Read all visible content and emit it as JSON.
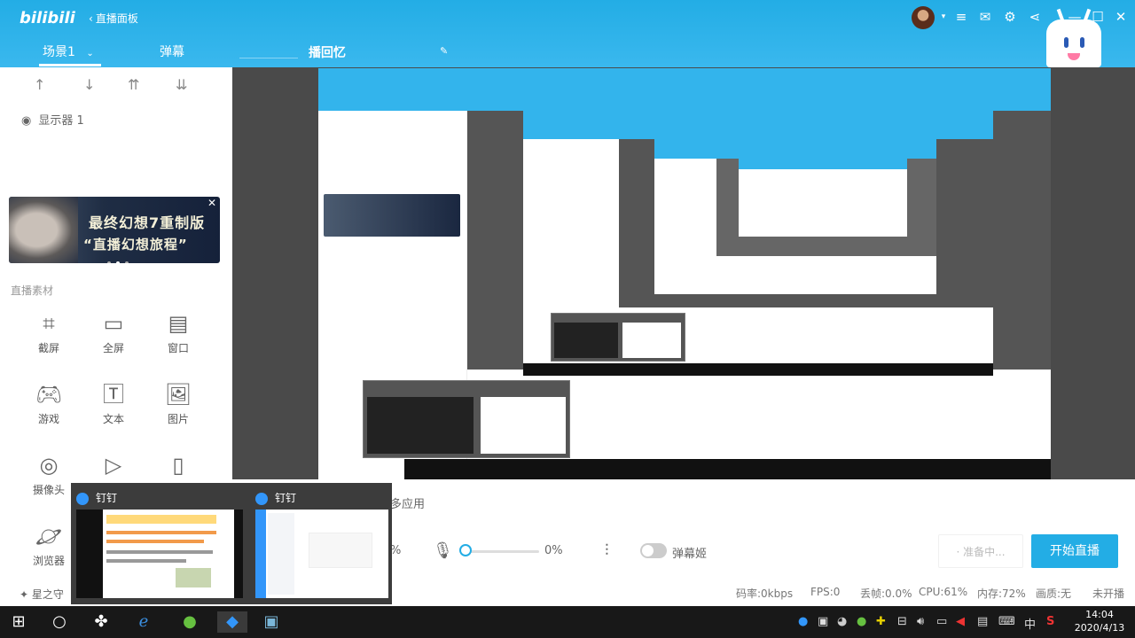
{
  "header": {
    "logo": "bilibili",
    "back_label": "直播面板",
    "scene_tab": "场景1",
    "danmu_tab": "弹幕",
    "room_title": "播回忆",
    "brand_color": "#23ade5"
  },
  "sidebar": {
    "display_item": "显示器 1",
    "banner_line1": "最终幻想7重制版",
    "banner_line2": "直播幻想旅程",
    "section_title": "直播素材",
    "tools": [
      {
        "label": "截屏",
        "icon": "crop-icon"
      },
      {
        "label": "全屏",
        "icon": "monitor-icon"
      },
      {
        "label": "窗口",
        "icon": "window-icon"
      },
      {
        "label": "游戏",
        "icon": "gamepad-icon"
      },
      {
        "label": "文本",
        "icon": "text-icon"
      },
      {
        "label": "图片",
        "icon": "image-icon"
      },
      {
        "label": "摄像头",
        "icon": "camera-icon"
      },
      {
        "label": "",
        "icon": "video-icon"
      },
      {
        "label": "",
        "icon": "phone-icon"
      },
      {
        "label": "浏览器",
        "icon": "planet-icon"
      }
    ],
    "star_label": "星之守"
  },
  "controls": {
    "multi_app": "多应用",
    "left_percent": "%",
    "mic_value": "0%",
    "danmu_toggle_label": "弹幕姬",
    "ready_label": "· 准备中...",
    "start_label": "开始直播"
  },
  "status": {
    "bitrate": "码率:0kbps",
    "fps": "FPS:0",
    "dropped": "丢帧:0.0%",
    "cpu": "CPU:61%",
    "memory": "内存:72%",
    "quality": "画质:无",
    "live_state": "未开播"
  },
  "taskbar_popup": {
    "card1_title": "钉钉",
    "card2_title": "钉钉"
  },
  "taskbar": {
    "time": "14:04",
    "date": "2020/4/13",
    "ime": "中"
  }
}
